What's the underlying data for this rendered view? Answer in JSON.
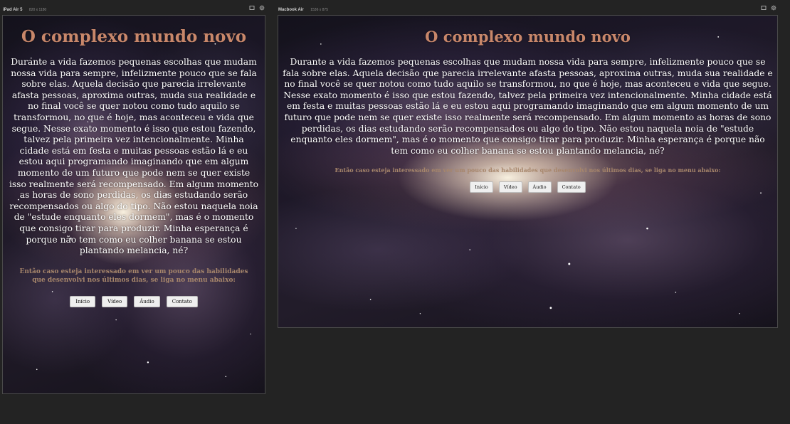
{
  "devices": [
    {
      "name": "iPad Air 5",
      "dims": "820 x 1180"
    },
    {
      "name": "Macbook Air",
      "dims": "1536 x 875"
    }
  ],
  "page": {
    "title": "O complexo mundo novo",
    "intro": "Durante a vida fazemos pequenas escolhas que mudam nossa vida para sempre, infelizmente pouco que se fala sobre elas. Aquela decisão que parecia irrelevante afasta pessoas, aproxima outras, muda sua realidade e no final você se quer notou como tudo aquilo se transformou, no que é hoje, mas aconteceu e vida que segue. Nesse exato momento é isso que estou fazendo, talvez pela primeira vez intencionalmente. Minha cidade está em festa e muitas pessoas estão lá e eu estou aqui programando imaginando que em algum momento de um futuro que pode nem se quer existe isso realmente será recompensado. Em algum momento as horas de sono perdidas, os dias estudando serão recompensados ou algo do tipo. Não estou naquela noia de \"estude enquanto eles dormem\", mas é o momento que consigo tirar para produzir. Minha esperança é porque não tem como eu colher banana se estou plantando melancia, né?",
    "menu_note": "Então caso esteja interessado em ver um pouco das habilidades que desenvolvi nos últimos dias, se liga no menu abaixo:",
    "menu": [
      "Início",
      "Vídeo",
      "Áudio",
      "Contato"
    ]
  },
  "colors": {
    "title": "#c8876a",
    "menu_note": "#a7866b",
    "text": "#ffffff",
    "background": "#232323"
  },
  "icons": [
    "window-icon",
    "gear-icon"
  ]
}
